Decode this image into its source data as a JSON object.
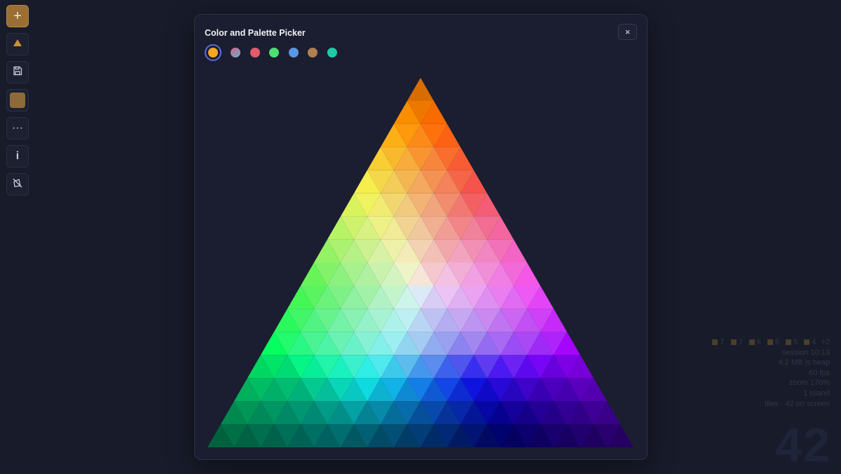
{
  "panel": {
    "title": "Color and Palette Picker",
    "close_label": "×",
    "palettes": [
      {
        "name": "amber",
        "color": "#f5a623"
      },
      {
        "name": "gradient",
        "color": "linear-gradient(135deg,#e0607e 0%,#5bb4d8 100%)"
      },
      {
        "name": "red",
        "color": "#e25c6c"
      },
      {
        "name": "green",
        "color": "#4fde72"
      },
      {
        "name": "blue",
        "color": "#5a96e6"
      },
      {
        "name": "tan",
        "color": "#b07f52"
      },
      {
        "name": "teal",
        "color": "#22c9a6"
      }
    ],
    "selected_palette": 0
  },
  "toolbar": {
    "add_label": "+",
    "triangle_label": "▲",
    "more_label": "···",
    "info_label": "i",
    "swatch_color": "#8e6a3a"
  },
  "stats": {
    "legend": [
      "7",
      "7",
      "6",
      "6",
      "5",
      "4",
      "+2"
    ],
    "session": "session 10:13",
    "heap": "4.2 MB js heap",
    "fps": "60 fps",
    "zoom": "zoom 170%",
    "islands": "1 island",
    "tiles": "tiles · 42 on screen"
  },
  "tile_count": "42",
  "triangle": {
    "rows": 16,
    "corners": {
      "top": "#6a18b0",
      "left": "#000000",
      "right": "#000000"
    }
  }
}
